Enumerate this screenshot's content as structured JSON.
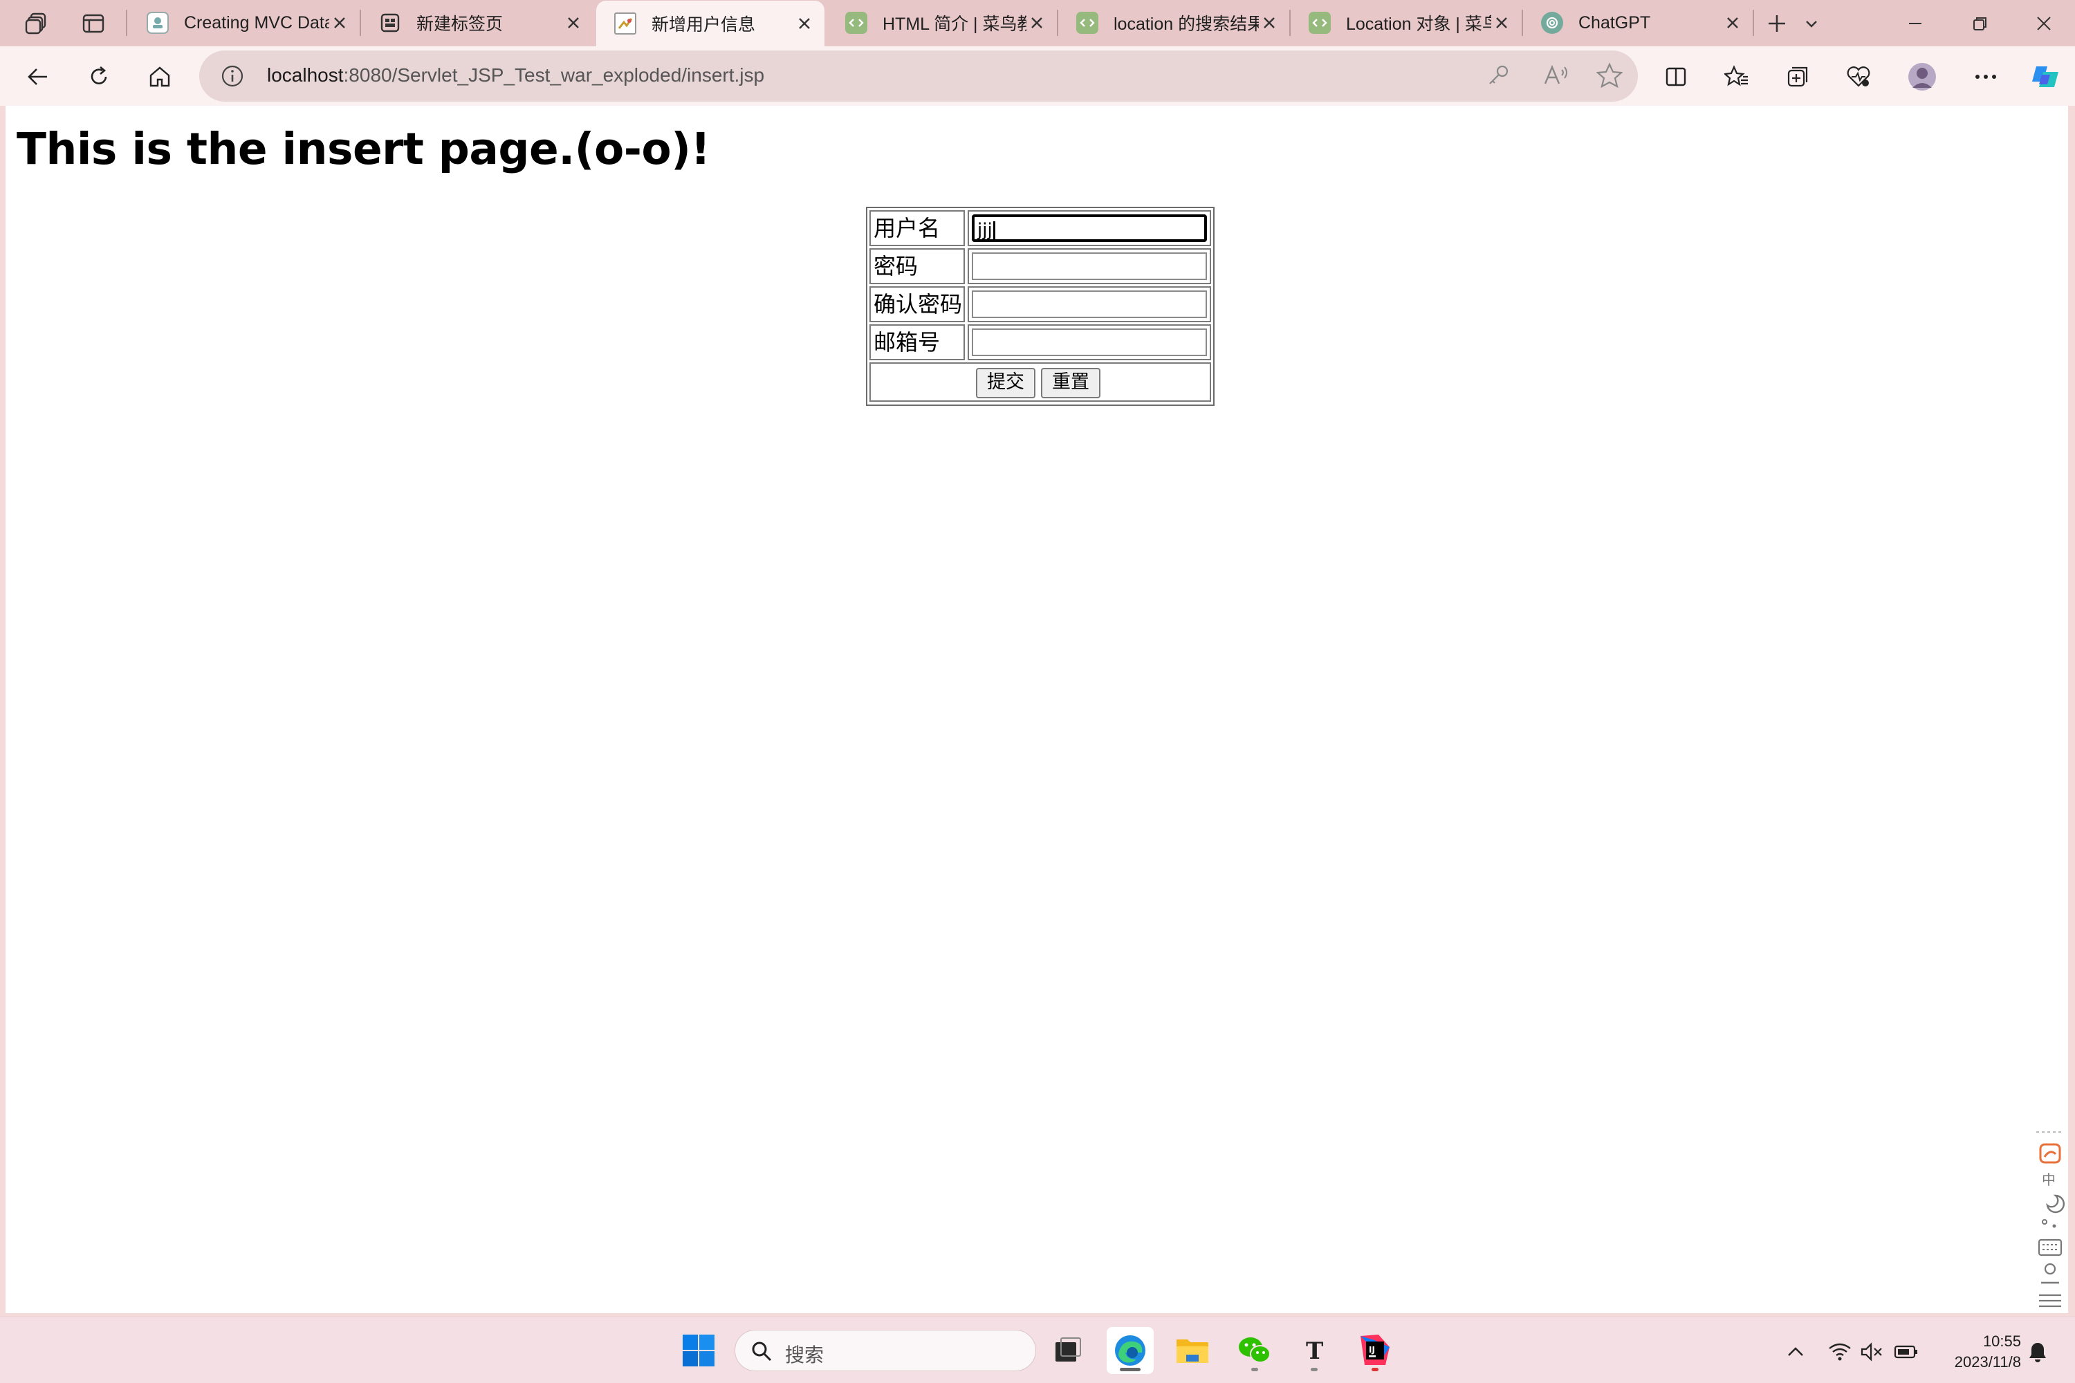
{
  "browser": {
    "tabs": [
      {
        "title": "Creating MVC Data",
        "active": false
      },
      {
        "title": "新建标签页",
        "active": false
      },
      {
        "title": "新增用户信息",
        "active": true
      },
      {
        "title": "HTML 简介 | 菜鸟教",
        "active": false
      },
      {
        "title": "location 的搜索结果",
        "active": false
      },
      {
        "title": "Location 对象 | 菜鸟",
        "active": false
      },
      {
        "title": "ChatGPT",
        "active": false
      }
    ],
    "url_host": "localhost",
    "url_path": ":8080/Servlet_JSP_Test_war_exploded/insert.jsp"
  },
  "page": {
    "heading": "This is the insert page.(o-o)!",
    "form": {
      "username_label": "用户名",
      "username_value": "jjj",
      "password_label": "密码",
      "confirm_label": "确认密码",
      "email_label": "邮箱号",
      "submit_label": "提交",
      "reset_label": "重置"
    }
  },
  "taskbar": {
    "search_placeholder": "搜索",
    "time": "10:55",
    "date": "2023/11/8"
  },
  "colors": {
    "tabstrip": "#e8c7c8",
    "toolbar": "#fbf1f1",
    "omnibox": "#e8d5d6",
    "taskbar": "#f3dfe4"
  }
}
